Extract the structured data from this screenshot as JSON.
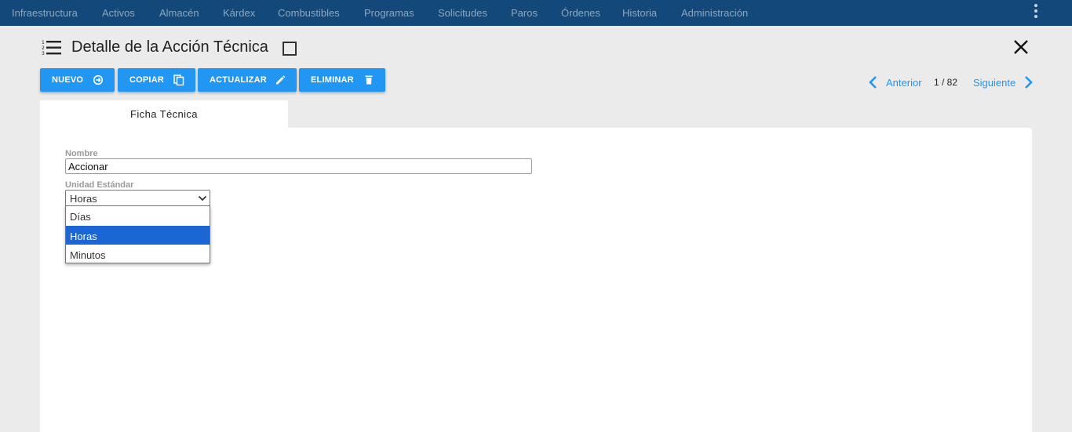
{
  "nav": {
    "items": [
      "Infraestructura",
      "Activos",
      "Almacén",
      "Kárdex",
      "Combustibles",
      "Programas",
      "Solicitudes",
      "Paros",
      "Órdenes",
      "Historia",
      "Administración"
    ],
    "icon_more": "more-vertical-icon"
  },
  "page": {
    "title": "Detalle de la Acción Técnica",
    "icon": "list-numbered-icon",
    "close_icon": "close-icon"
  },
  "toolbar": {
    "nuevo": "NUEVO",
    "copiar": "COPIAR",
    "actualizar": "ACTUALIZAR",
    "eliminar": "ELIMINAR",
    "button_color": "#2196f3"
  },
  "pager": {
    "prev": "Anterior",
    "count": "1 / 82",
    "next": "Siguiente"
  },
  "tabs": [
    "Ficha Técnica"
  ],
  "form": {
    "nombre_label": "Nombre",
    "nombre_value": "Accionar",
    "unidad_label": "Unidad Estándar",
    "unidad_value": "Horas",
    "unidad_options": [
      "Días",
      "Horas",
      "Minutos"
    ]
  },
  "colors": {
    "nav_bg": "#12497a",
    "accent": "#2196f3",
    "selected_option": "#1a66d4"
  }
}
